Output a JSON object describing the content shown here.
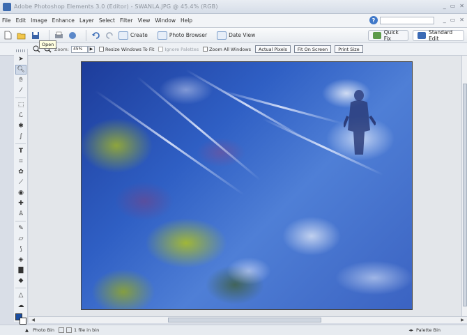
{
  "window": {
    "title": "Adobe Photoshop Elements 3.0 (Editor) - SWANLA.JPG @ 45.4% (RGB)",
    "controls": [
      "_",
      "▭",
      "✕"
    ]
  },
  "menu": {
    "items": [
      "File",
      "Edit",
      "Image",
      "Enhance",
      "Layer",
      "Select",
      "Filter",
      "View",
      "Window",
      "Help"
    ],
    "right_controls": [
      "_",
      "▭",
      "✕"
    ]
  },
  "toolbar": {
    "create_label": "Create",
    "photo_browser_label": "Photo Browser",
    "date_view_label": "Date View",
    "quick_fix_label": "Quick Fix",
    "standard_edit_label": "Standard Edit"
  },
  "tooltip": {
    "text": "Open"
  },
  "options": {
    "zoom_label": "Zoom:",
    "zoom_value": "45%",
    "resize_windows_label": "Resize Windows To Fit",
    "ignore_palettes_label": "Ignore Palettes",
    "zoom_all_label": "Zoom All Windows",
    "actual_pixels_label": "Actual Pixels",
    "fit_on_screen_label": "Fit On Screen",
    "print_size_label": "Print Size"
  },
  "status": {
    "photo_bin_label": "Photo Bin",
    "files_label": "1 file in bin",
    "palette_bin_label": "Palette Bin"
  },
  "colors": {
    "foreground": "#1a4da0",
    "background": "#ffffff",
    "accent": "#3f78c9"
  },
  "icons": {
    "tools": [
      "move-tool",
      "zoom-tool",
      "hand-tool",
      "eyedropper-tool",
      "marquee-tool",
      "lasso-tool",
      "magic-wand-tool",
      "selection-brush-tool",
      "type-tool",
      "crop-tool",
      "cookie-cutter-tool",
      "straighten-tool",
      "red-eye-tool",
      "healing-brush-tool",
      "clone-stamp-tool",
      "pencil-tool",
      "eraser-tool",
      "brush-tool",
      "paint-bucket-tool",
      "gradient-tool",
      "shape-tool",
      "blur-tool",
      "sponge-tool"
    ]
  }
}
